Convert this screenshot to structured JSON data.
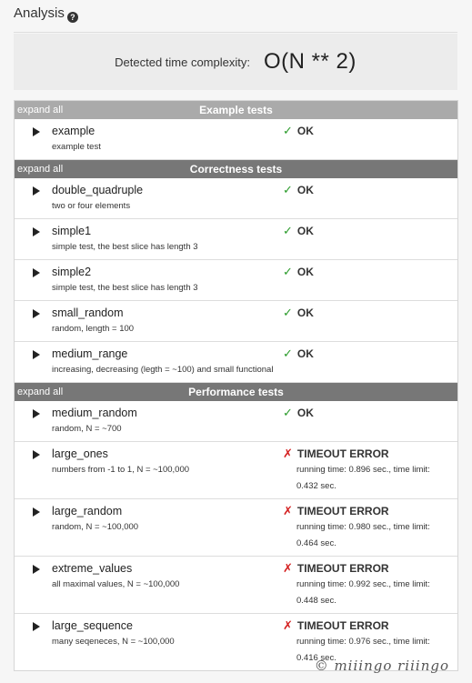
{
  "header": {
    "title": "Analysis",
    "help_icon": "?"
  },
  "complexity": {
    "label": "Detected time complexity:",
    "value": "O(N ** 2)"
  },
  "groups": [
    {
      "expand_label": "expand all",
      "title": "Example tests",
      "tests": [
        {
          "name": "example",
          "desc": "example test",
          "status": "OK",
          "mark": "✓"
        }
      ]
    },
    {
      "expand_label": "expand all",
      "title": "Correctness tests",
      "tests": [
        {
          "name": "double_quadruple",
          "desc": "two or four elements",
          "status": "OK",
          "mark": "✓"
        },
        {
          "name": "simple1",
          "desc": "simple test, the best slice has length 3",
          "status": "OK",
          "mark": "✓"
        },
        {
          "name": "simple2",
          "desc": "simple test, the best slice has length 3",
          "status": "OK",
          "mark": "✓"
        },
        {
          "name": "small_random",
          "desc": "random, length = 100",
          "status": "OK",
          "mark": "✓"
        },
        {
          "name": "medium_range",
          "desc": "increasing, decreasing (legth = ~100) and small functional",
          "status": "OK",
          "mark": "✓"
        }
      ]
    },
    {
      "expand_label": "expand all",
      "title": "Performance tests",
      "tests": [
        {
          "name": "medium_random",
          "desc": "random, N = ~700",
          "status": "OK",
          "mark": "✓"
        },
        {
          "name": "large_ones",
          "desc": "numbers from -1 to 1, N = ~100,000",
          "status": "TIMEOUT ERROR",
          "mark": "✗",
          "detail": "running time: 0.896 sec., time limit: 0.432 sec."
        },
        {
          "name": "large_random",
          "desc": "random, N = ~100,000",
          "status": "TIMEOUT ERROR",
          "mark": "✗",
          "detail": "running time: 0.980 sec., time limit: 0.464 sec."
        },
        {
          "name": "extreme_values",
          "desc": "all maximal values, N = ~100,000",
          "status": "TIMEOUT ERROR",
          "mark": "✗",
          "detail": "running time: 0.992 sec., time limit: 0.448 sec."
        },
        {
          "name": "large_sequence",
          "desc": "many seqeneces, N = ~100,000",
          "status": "TIMEOUT ERROR",
          "mark": "✗",
          "detail": "running time: 0.976 sec., time limit: 0.416 sec."
        }
      ]
    }
  ],
  "footer": {
    "watermark": "© miiingo riiingo"
  },
  "colors": {
    "ok": "#2a9b2a",
    "error": "#d42020",
    "example_header": "#aaaaaa",
    "group_header": "#777777"
  }
}
